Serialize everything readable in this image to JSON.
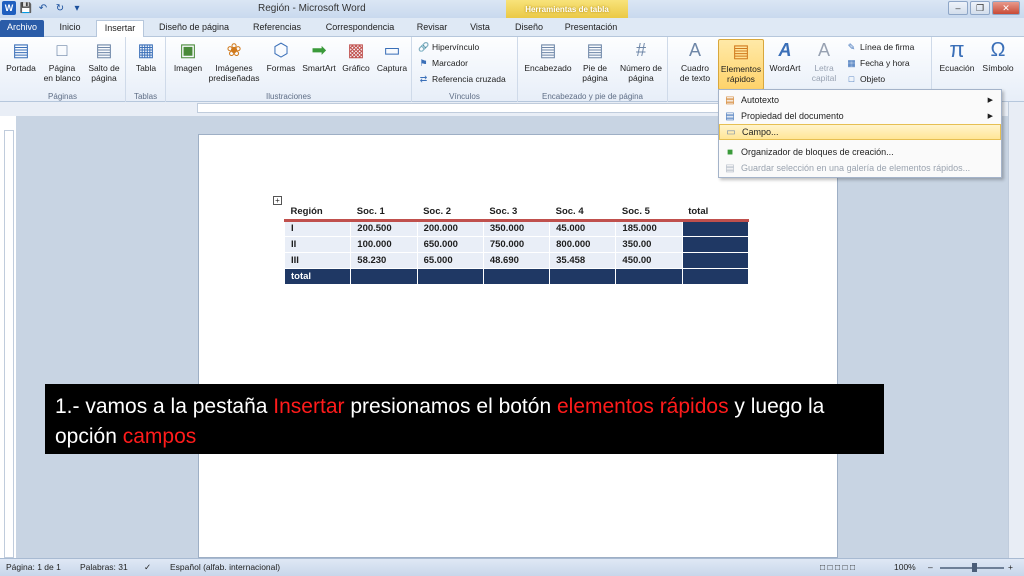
{
  "titlebar": {
    "title": "Región  -  Microsoft Word",
    "context_tab_group": "Herramientas de tabla",
    "word_icon": "W",
    "qat_icons": [
      "save-icon",
      "undo-icon",
      "redo-icon",
      "customize-icon"
    ]
  },
  "tabs": [
    "Archivo",
    "Inicio",
    "Insertar",
    "Diseño de página",
    "Referencias",
    "Correspondencia",
    "Revisar",
    "Vista",
    "Diseño",
    "Presentación"
  ],
  "ribbon": {
    "groups": {
      "paginas": {
        "label": "Páginas",
        "buttons": [
          "Portada",
          "Página\nen blanco",
          "Salto de\npágina"
        ]
      },
      "tablas": {
        "label": "Tablas",
        "buttons": [
          "Tabla"
        ]
      },
      "ilustraciones": {
        "label": "Ilustraciones",
        "buttons": [
          "Imagen",
          "Imágenes\nprediseñadas",
          "Formas",
          "SmartArt",
          "Gráfico",
          "Captura"
        ]
      },
      "vinculos": {
        "label": "Vínculos",
        "buttons": [
          "Hipervínculo",
          "Marcador",
          "Referencia cruzada"
        ]
      },
      "encabezado": {
        "label": "Encabezado y pie de página",
        "buttons": [
          "Encabezado",
          "Pie de\npágina",
          "Número de\npágina"
        ]
      },
      "texto": {
        "buttons": [
          "Cuadro\nde texto",
          "Elementos\nrápidos",
          "WordArt",
          "Letra\ncapital"
        ],
        "small": [
          "Línea de firma",
          "Fecha y hora",
          "Objeto"
        ]
      },
      "simbolos": {
        "buttons": [
          "Ecuación",
          "Símbolo"
        ]
      }
    }
  },
  "dropdown": {
    "items": [
      {
        "label": "Autotexto",
        "submenu": true
      },
      {
        "label": "Propiedad del documento",
        "submenu": true
      },
      {
        "label": "Campo...",
        "highlighted": true
      },
      {
        "label": "Organizador de bloques de creación..."
      },
      {
        "label": "Guardar selección en una galería de elementos rápidos...",
        "disabled": true
      }
    ]
  },
  "table": {
    "headers": [
      "Región",
      "Soc. 1",
      "Soc. 2",
      "Soc. 3",
      "Soc. 4",
      "Soc. 5",
      "total"
    ],
    "rows": [
      [
        "I",
        "200.500",
        "200.000",
        "350.000",
        "45.000",
        "185.000",
        ""
      ],
      [
        "II",
        "100.000",
        "650.000",
        "750.000",
        "800.000",
        "350.00",
        ""
      ],
      [
        "III",
        "58.230",
        "65.000",
        "48.690",
        "35.458",
        "450.00",
        ""
      ]
    ],
    "total_row": [
      "total",
      "",
      "",
      "",
      "",
      "",
      ""
    ]
  },
  "caption": {
    "part1": "1.- vamos a la pestaña ",
    "highlight1": "Insertar",
    "part2": " presionamos el botón ",
    "highlight2": "elementos rápidos",
    "part3": " y luego la opción ",
    "highlight3": "campos"
  },
  "statusbar": {
    "page": "Página: 1 de 1",
    "words": "Palabras: 31",
    "language": "Español (alfab. internacional)",
    "zoom": "100%"
  },
  "colors": {
    "file_tab": "#2a5ca8",
    "table_dark": "#1f3864",
    "table_accent": "#c0504d",
    "caption_red": "#ff1b1b"
  }
}
